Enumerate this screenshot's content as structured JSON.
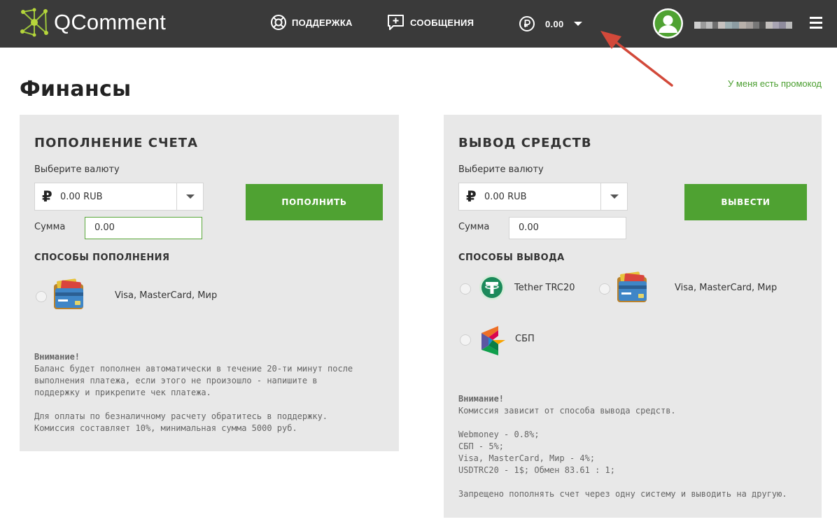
{
  "header": {
    "logo_text": "QComment",
    "nav": {
      "support_label": "ПОДДЕРЖКА",
      "messages_label": "СООБЩЕНИЯ",
      "balance_value": "0.00"
    },
    "colors": {
      "bar": "#3a3a3a",
      "avatar": "#4fa232"
    }
  },
  "page": {
    "title": "Финансы",
    "promo_link": "У меня есть промокод"
  },
  "deposit": {
    "title": "ПОПОЛНЕНИЕ СЧЕТА",
    "currency_label": "Выберите валюту",
    "currency_symbol": "₽",
    "currency_value": "0.00 RUB",
    "amount_label": "Сумма",
    "amount_value": "0.00",
    "button_label": "ПОПОЛНИТЬ",
    "methods_title": "СПОСОБЫ ПОПОЛНЕНИЯ",
    "methods": [
      {
        "label": "Visa, MasterCard, Мир",
        "icon": "card-wallet-icon"
      }
    ],
    "note_title": "Внимание!",
    "note_lines": [
      "Баланс будет пополнен автоматически в течение 20-ти минут после",
      "выполнения платежа, если этого не произошло - напишите в",
      "поддержку и прикрепите чек платежа."
    ],
    "note2_lines": [
      "Для оплаты по безналичному расчету обратитесь в поддержку.",
      "Комиссия составляет 10%, минимальная сумма 5000 руб."
    ]
  },
  "withdraw": {
    "title": "ВЫВОД СРЕДСТВ",
    "currency_label": "Выберите валюту",
    "currency_symbol": "₽",
    "currency_value": "0.00 RUB",
    "amount_label": "Сумма",
    "amount_value": "0.00",
    "button_label": "ВЫВЕСТИ",
    "methods_title": "СПОСОБЫ ВЫВОДА",
    "methods": [
      {
        "label": "Tether TRC20",
        "icon": "tether-icon"
      },
      {
        "label": "Visa, MasterCard, Мир",
        "icon": "card-wallet-icon"
      },
      {
        "label": "СБП",
        "icon": "sbp-icon"
      }
    ],
    "note_title": "Внимание!",
    "note_line": "Комиссия зависит от способа вывода средств.",
    "fees": [
      "Webmoney - 0.8%;",
      "СБП - 5%;",
      "Visa, MasterCard, Мир - 4%;",
      "USDTRC20 - 1$; Обмен 83.61 : 1;"
    ],
    "note_footer": "Запрещено пополнять счет через одну систему и выводить на другую."
  }
}
